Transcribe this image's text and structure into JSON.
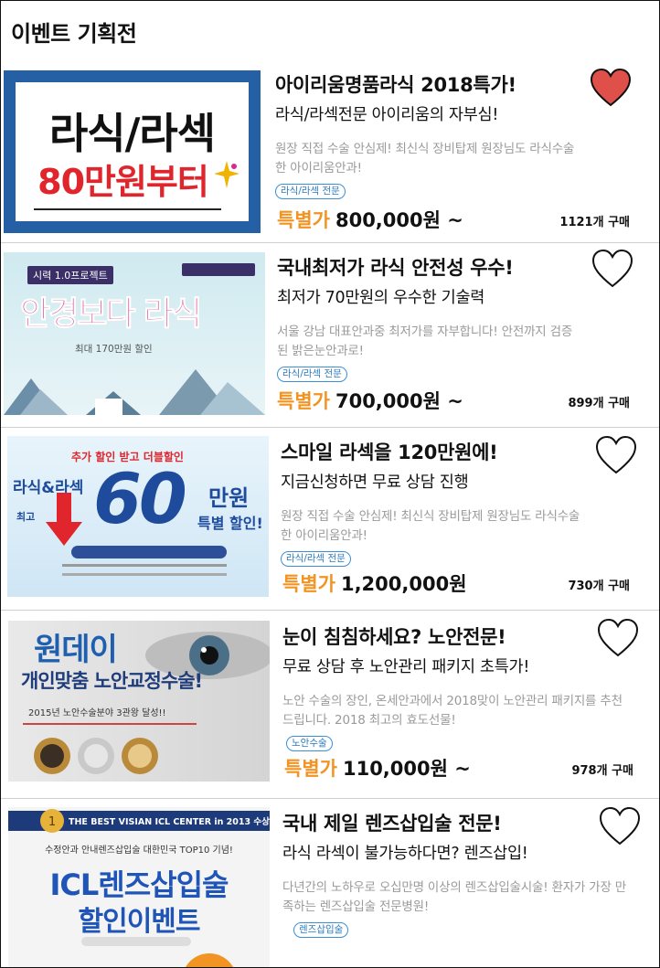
{
  "page": {
    "title": "이벤트 기획전"
  },
  "events": [
    {
      "banner_lines": [
        "라식/라섹",
        "80만원부터"
      ],
      "title": "아이리움명품라식 2018특가!",
      "subtitle": "라식/라섹전문 아이리움의 자부심!",
      "desc": "원장 직접 수술 안심제! 최신식 장비탑제 원장님도 라식수술한 아이리움안과!",
      "tag": "라식/라섹 전문",
      "price_label": "특별가",
      "price": "800,000원 ~",
      "buy_count": "1121개 구매",
      "liked": true
    },
    {
      "banner_lines": [
        "시력 1.0프로젝트",
        "안경보다 라식",
        "최대 170만원 할인"
      ],
      "title": "국내최저가 라식 안전성 우수!",
      "subtitle": "최저가 70만원의 우수한 기술력",
      "desc": "서울 강남 대표안과중 최저가를 자부합니다! 안전까지 검증된 밝은눈안과로!",
      "tag": "라식/라섹 전문",
      "price_label": "특별가",
      "price": "700,000원 ~",
      "buy_count": "899개 구매",
      "liked": false
    },
    {
      "banner_lines": [
        "추가 할인 받고 더블할인",
        "라식&라섹",
        "60",
        "만원",
        "특별 할인!",
        "최고"
      ],
      "title": "스마일 라섹을 120만원에!",
      "subtitle": "지금신청하면 무료 상담 진행",
      "desc": "원장 직접 수술 안심제! 최신식 장비탑제 원장님도 라식수술한 아이리움안과!",
      "tag": "라식/라섹 전문",
      "price_label": "특별가",
      "price": "1,200,000원",
      "buy_count": "730개 구매",
      "liked": false
    },
    {
      "banner_lines": [
        "원데이",
        "개인맞춤 노안교정수술!",
        "2015년 노안수술분야 3관왕 달성!!"
      ],
      "title": "눈이 침침하세요? 노안전문!",
      "subtitle": "무료 상담 후 노안관리 패키지 초특가!",
      "desc": "노안 수술의 장인, 온세안과에서 2018맞이 노안관리 패키지를 추천드립니다. 2018 최고의 효도선물!",
      "tag": "노안수술",
      "price_label": "특별가",
      "price": "110,000원 ~",
      "buy_count": "978개 구매",
      "liked": false
    },
    {
      "banner_lines": [
        "THE BEST VISIAN ICL CENTER in 2013 수상",
        "수정안과 안내렌즈삽입술 대한민국 TOP10 기념!",
        "ICL렌즈삽입술",
        "할인이벤트"
      ],
      "title": "국내 제일 렌즈삽입술 전문!",
      "subtitle": "라식 라섹이 불가능하다면? 렌즈삽입!",
      "desc": "다년간의 노하우로 오십만명 이상의 렌즈삽입술시술! 환자가 가장 만족하는 렌즈삽입술 전문병원!",
      "tag": "렌즈삽입술",
      "liked": false
    }
  ],
  "colors": {
    "accent": "#f29423",
    "heart_fill": "#e0504a",
    "tag_border": "#3a8fd6"
  }
}
